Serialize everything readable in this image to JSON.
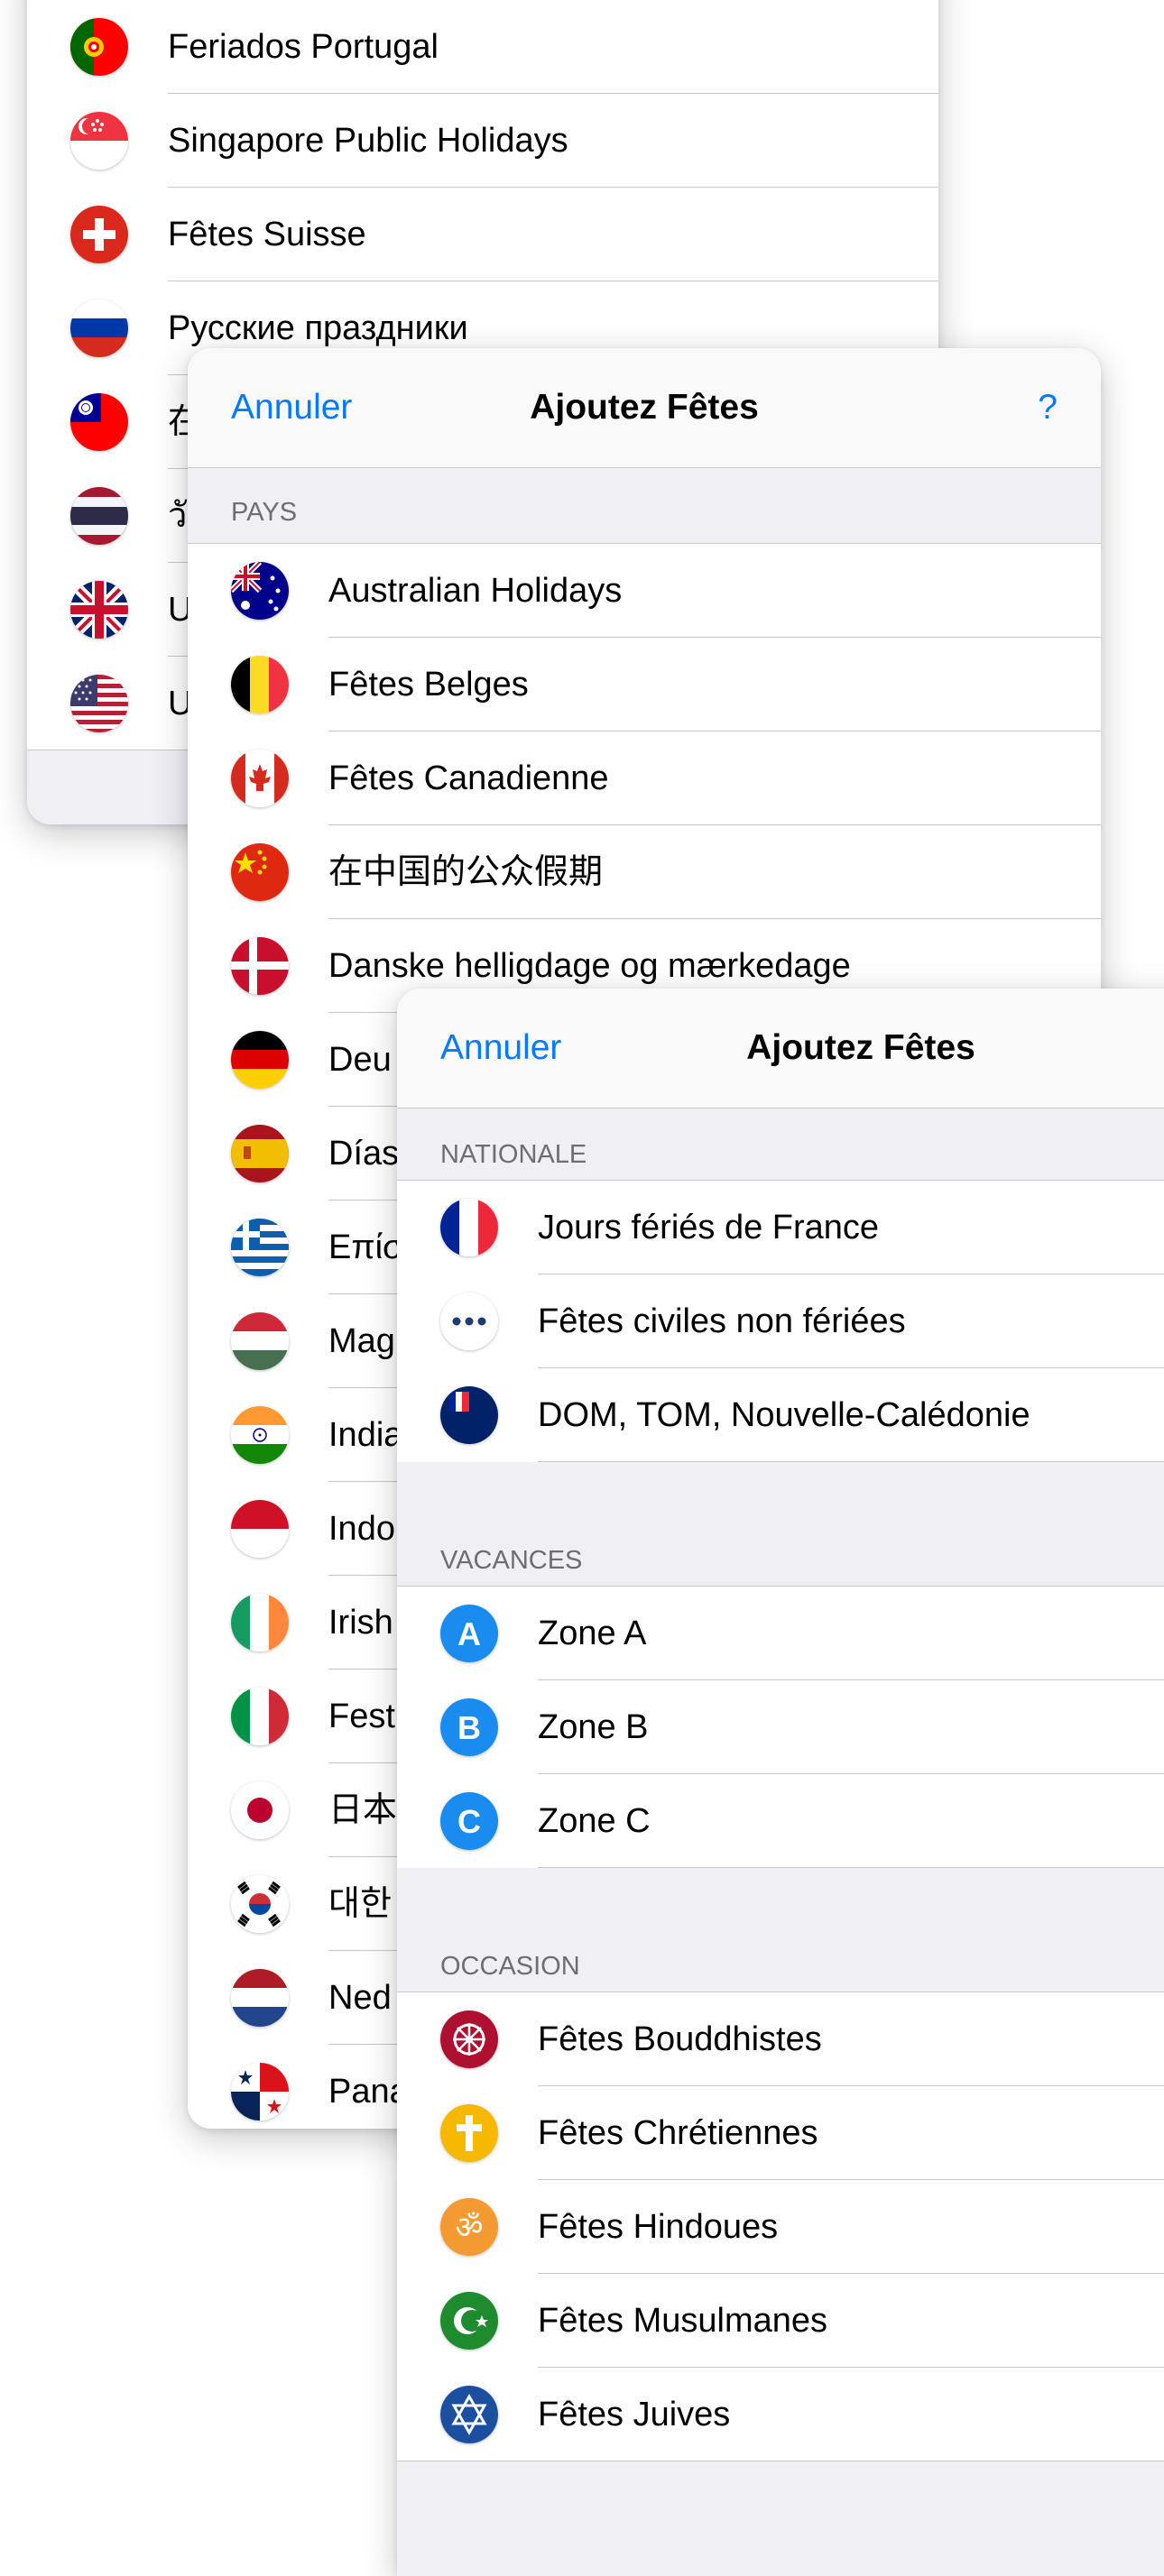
{
  "sheet1": {
    "rows": [
      {
        "label": "Feriados Portugal",
        "icon": "portugal-flag-icon"
      },
      {
        "label": "Singapore Public Holidays",
        "icon": "singapore-flag-icon"
      },
      {
        "label": "Fêtes Suisse",
        "icon": "switzerland-flag-icon"
      },
      {
        "label": "Русские праздники",
        "icon": "russia-flag-icon"
      },
      {
        "label": "在",
        "icon": "taiwan-flag-icon"
      },
      {
        "label": "วั",
        "icon": "thailand-flag-icon"
      },
      {
        "label": "U",
        "icon": "uk-flag-icon"
      },
      {
        "label": "U",
        "icon": "usa-flag-icon"
      }
    ]
  },
  "sheet2": {
    "nav": {
      "cancel": "Annuler",
      "title": "Ajoutez Fêtes",
      "help": "?"
    },
    "section_header": "PAYS",
    "rows": [
      {
        "label": "Australian Holidays",
        "icon": "australia-flag-icon"
      },
      {
        "label": "Fêtes Belges",
        "icon": "belgium-flag-icon"
      },
      {
        "label": "Fêtes Canadienne",
        "icon": "canada-flag-icon"
      },
      {
        "label": "在中国的公众假期",
        "icon": "china-flag-icon"
      },
      {
        "label": "Danske helligdage og mærkedage",
        "icon": "denmark-flag-icon"
      },
      {
        "label": "Deu",
        "icon": "germany-flag-icon"
      },
      {
        "label": "Días",
        "icon": "spain-flag-icon"
      },
      {
        "label": "Επίσ",
        "icon": "greece-flag-icon"
      },
      {
        "label": "Mag",
        "icon": "hungary-flag-icon"
      },
      {
        "label": "India",
        "icon": "india-flag-icon"
      },
      {
        "label": "Indo",
        "icon": "indonesia-flag-icon"
      },
      {
        "label": "Irish",
        "icon": "ireland-flag-icon"
      },
      {
        "label": "Fest",
        "icon": "italy-flag-icon"
      },
      {
        "label": "日本",
        "icon": "japan-flag-icon"
      },
      {
        "label": "대한",
        "icon": "korea-flag-icon"
      },
      {
        "label": "Ned",
        "icon": "netherlands-flag-icon"
      },
      {
        "label": "Pana",
        "icon": "panama-flag-icon"
      }
    ]
  },
  "sheet3": {
    "nav": {
      "cancel": "Annuler",
      "title": "Ajoutez Fêtes"
    },
    "sections": [
      {
        "header": "NATIONALE",
        "rows": [
          {
            "label": "Jours fériés de France",
            "icon": "france-flag-icon"
          },
          {
            "label": "Fêtes civiles non fériées",
            "icon": "ellipsis-icon"
          },
          {
            "label": "DOM, TOM, Nouvelle-Calédonie",
            "icon": "overseas-flag-icon"
          }
        ]
      },
      {
        "header": "VACANCES",
        "rows": [
          {
            "label": "Zone A",
            "icon": "zone-a-icon",
            "letter": "A"
          },
          {
            "label": "Zone B",
            "icon": "zone-b-icon",
            "letter": "B"
          },
          {
            "label": "Zone C",
            "icon": "zone-c-icon",
            "letter": "C"
          }
        ]
      },
      {
        "header": "OCCASION",
        "rows": [
          {
            "label": "Fêtes Bouddhistes",
            "icon": "dharma-wheel-icon"
          },
          {
            "label": "Fêtes Chrétiennes",
            "icon": "cross-icon"
          },
          {
            "label": "Fêtes Hindoues",
            "icon": "om-icon"
          },
          {
            "label": "Fêtes Musulmanes",
            "icon": "crescent-icon"
          },
          {
            "label": "Fêtes Juives",
            "icon": "star-of-david-icon"
          }
        ]
      }
    ]
  },
  "colors": {
    "accent": "#007aff",
    "group_bg": "#efeff4",
    "separator": "#c8c7cc"
  }
}
